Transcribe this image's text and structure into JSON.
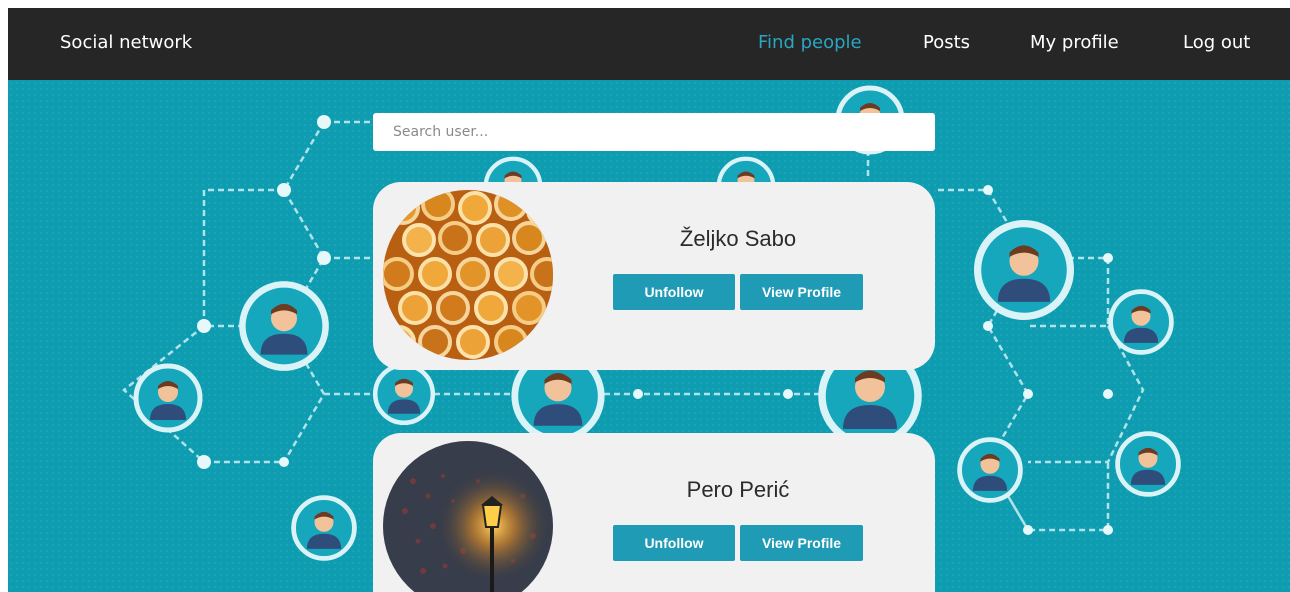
{
  "navbar": {
    "brand": "Social network",
    "links": [
      {
        "label": "Find people",
        "active": true
      },
      {
        "label": "Posts",
        "active": false
      },
      {
        "label": "My profile",
        "active": false
      },
      {
        "label": "Log out",
        "active": false
      }
    ]
  },
  "search": {
    "placeholder": "Search user..."
  },
  "users": [
    {
      "name": "Željko Sabo",
      "follow_label": "Unfollow",
      "view_label": "View Profile",
      "avatar": "honeycomb-photo"
    },
    {
      "name": "Pero Perić",
      "follow_label": "Unfollow",
      "view_label": "View Profile",
      "avatar": "street-lamp-photo"
    }
  ],
  "colors": {
    "navbar_bg": "#262626",
    "active_link": "#2aa6c4",
    "background": "#0e9cb1",
    "card_bg": "#f1f1f1",
    "button_bg": "#1f9bb5"
  }
}
